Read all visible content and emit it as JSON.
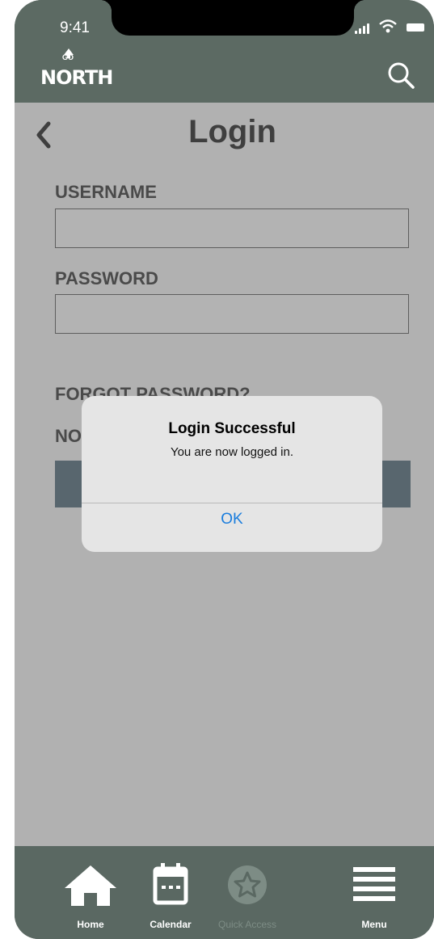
{
  "status_bar": {
    "time": "9:41"
  },
  "header": {
    "logo_top": "GO",
    "logo_main": "NORTH"
  },
  "page": {
    "title": "Login"
  },
  "form": {
    "username_label": "USERNAME",
    "username_value": "",
    "password_label": "PASSWORD",
    "password_value": "",
    "forgot_password": "FORGOT PASSWORD?",
    "signup_prefix": "NO"
  },
  "alert": {
    "title": "Login Successful",
    "message": "You are now logged in.",
    "ok_label": "OK"
  },
  "tabbar": {
    "items": [
      {
        "label": "Home",
        "icon": "home-icon"
      },
      {
        "label": "Calendar",
        "icon": "calendar-icon"
      },
      {
        "label": "Quick Access",
        "icon": "star-icon",
        "state": "disabled"
      },
      {
        "label": "Menu",
        "icon": "menu-icon"
      }
    ]
  },
  "colors": {
    "header": "#5c6a63",
    "content": "#b1b1b1",
    "alert_ok": "#1a7ddd",
    "tab_inactive": "#7d8c85"
  }
}
